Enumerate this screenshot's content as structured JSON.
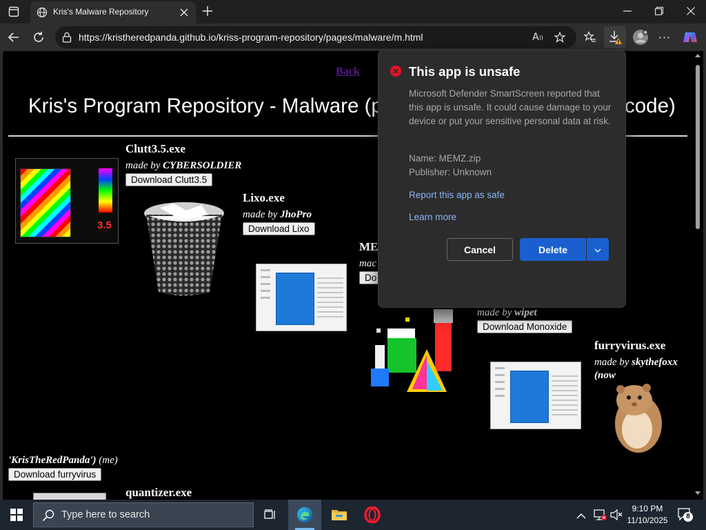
{
  "browser": {
    "tab_title": "Kris's Malware Repository",
    "url": "https://kristheredpanda.github.io/kriss-program-repository/pages/malware/m.html"
  },
  "page": {
    "back_link": "Back",
    "heading": "Kris's Program Repository - Malware (p",
    "heading_right": "code)",
    "items": [
      {
        "name": "Clutt3.5.exe",
        "made_by_prefix": "made by ",
        "author": "CYBERSOLDIER",
        "button": "Download Clutt3.5"
      },
      {
        "name": "Lixo.exe",
        "made_by_prefix": "made by ",
        "author": "JhoPro",
        "button": "Download Lixo"
      },
      {
        "name": "ME",
        "made_by_prefix": "mac",
        "author": "",
        "button": "Do"
      },
      {
        "name": "",
        "made_by_prefix": "made by ",
        "author": "wipet",
        "button": "Download Monoxide"
      },
      {
        "name": "furryvirus.exe",
        "made_by_prefix": "made by ",
        "author": "skythefoxx",
        "author_extra": "(now",
        "continuation_author": "'KrisTheRedPanda')",
        "continuation_suffix": " (me)",
        "button": "Download furryvirus"
      },
      {
        "name": "quantizer.exe"
      }
    ],
    "clutt_badge": "3.5"
  },
  "popup": {
    "title": "This app is unsafe",
    "message": "Microsoft Defender SmartScreen reported that this app is unsafe. It could cause damage to your device or put your sensitive personal data at risk.",
    "name_line": "Name: MEMZ.zip",
    "publisher_line": "Publisher: Unknown",
    "report_link": "Report this app as safe",
    "learn_link": "Learn more",
    "cancel_button": "Cancel",
    "delete_button": "Delete",
    "accent_color": "#1a5fd0",
    "danger_color": "#e81123"
  },
  "taskbar": {
    "search_placeholder": "Type here to search",
    "time": "9:10 PM",
    "date": "11/10/2025",
    "notification_count": "8"
  },
  "icons": [
    "window-menu-icon",
    "globe-icon",
    "close-icon",
    "plus-icon",
    "minimize-icon",
    "restore-icon",
    "back-icon",
    "refresh-icon",
    "lock-icon",
    "read-aloud-icon",
    "star-icon",
    "favorites-icon",
    "download-icon",
    "profile-icon",
    "more-icon",
    "copilot-icon",
    "error-icon",
    "chevron-down-icon",
    "windows-icon",
    "search-icon",
    "task-view-icon",
    "edge-icon",
    "folder-icon",
    "opera-icon",
    "tray-chevron-icon",
    "network-icon",
    "volume-muted-icon",
    "notification-icon"
  ]
}
